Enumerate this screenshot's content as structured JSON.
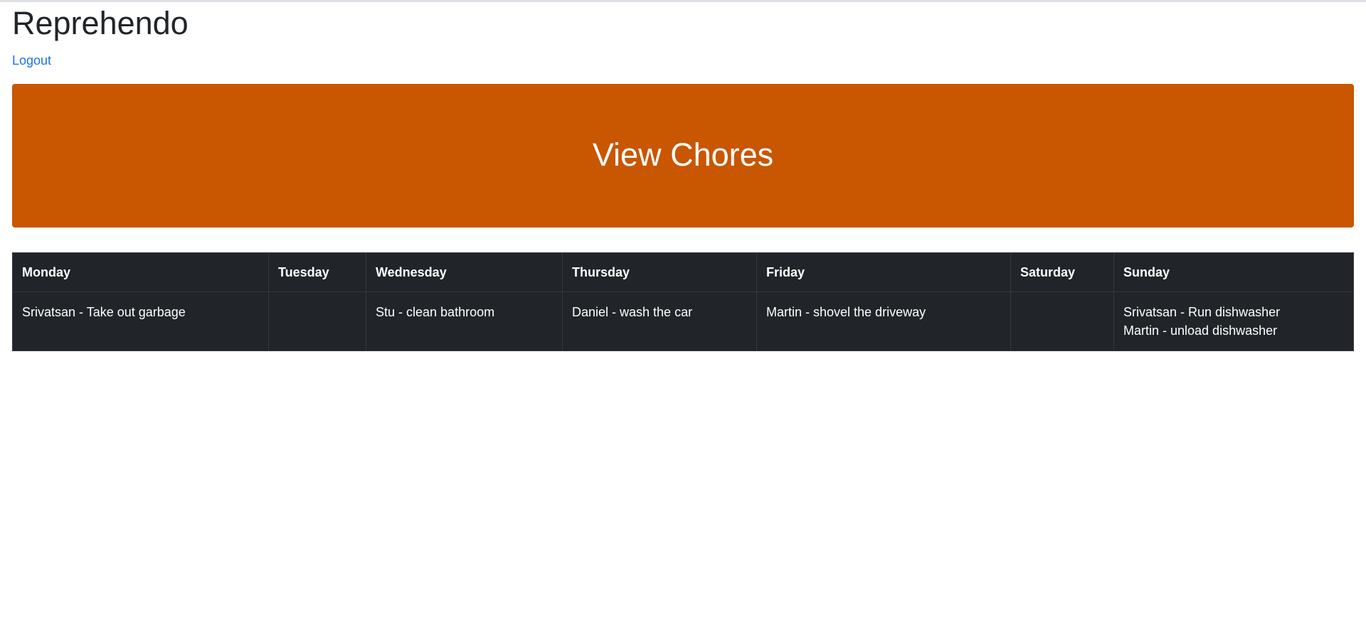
{
  "app": {
    "title": "Reprehendo",
    "logout_label": "Logout"
  },
  "hero": {
    "title": "View Chores",
    "color": "#c95600"
  },
  "table": {
    "headers": [
      "Monday",
      "Tuesday",
      "Wednesday",
      "Thursday",
      "Friday",
      "Saturday",
      "Sunday"
    ],
    "rows": [
      [
        [
          "Srivatsan - Take out garbage"
        ],
        [],
        [
          "Stu - clean bathroom"
        ],
        [
          "Daniel - wash the car"
        ],
        [
          "Martin - shovel the driveway"
        ],
        [],
        [
          "Srivatsan - Run dishwasher",
          "Martin - unload dishwasher"
        ]
      ]
    ]
  }
}
